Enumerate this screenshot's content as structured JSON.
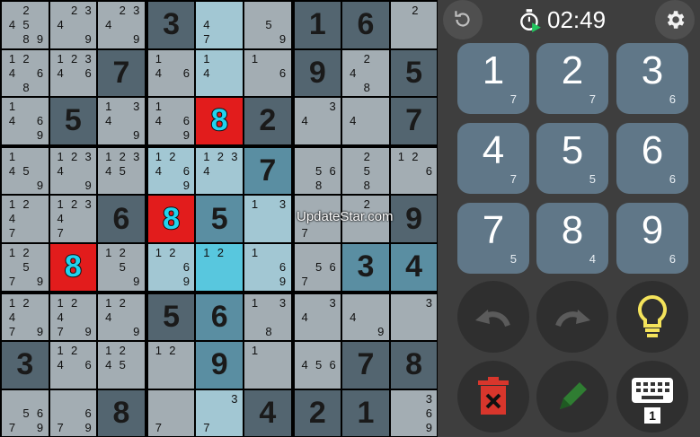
{
  "timer": "02:49",
  "watermark": "UpdateStar.com",
  "sudoku": {
    "cells": [
      [
        {
          "v": "",
          "n": "24589",
          "bg": "light"
        },
        {
          "v": "",
          "n": "2349",
          "bg": "light"
        },
        {
          "v": "",
          "n": "2349",
          "bg": "light"
        },
        {
          "v": "3",
          "n": "",
          "bg": "dark"
        },
        {
          "v": "",
          "n": "47",
          "bg": "lightblue"
        },
        {
          "v": "",
          "n": "59",
          "bg": "light"
        },
        {
          "v": "1",
          "n": "",
          "bg": "dark"
        },
        {
          "v": "6",
          "n": "",
          "bg": "dark"
        },
        {
          "v": "",
          "n": "2",
          "bg": "light"
        }
      ],
      [
        {
          "v": "",
          "n": "12468",
          "bg": "light"
        },
        {
          "v": "",
          "n": "12346",
          "bg": "light"
        },
        {
          "v": "7",
          "n": "",
          "bg": "dark"
        },
        {
          "v": "",
          "n": "146",
          "bg": "light"
        },
        {
          "v": "",
          "n": "14",
          "bg": "lightblue"
        },
        {
          "v": "",
          "n": "16",
          "bg": "light"
        },
        {
          "v": "9",
          "n": "",
          "bg": "dark"
        },
        {
          "v": "",
          "n": "248",
          "bg": "light"
        },
        {
          "v": "5",
          "n": "",
          "bg": "dark"
        }
      ],
      [
        {
          "v": "",
          "n": "1469",
          "bg": "light"
        },
        {
          "v": "5",
          "n": "",
          "bg": "dark"
        },
        {
          "v": "",
          "n": "1349",
          "bg": "light"
        },
        {
          "v": "",
          "n": "1469",
          "bg": "light"
        },
        {
          "v": "8",
          "n": "",
          "bg": "red"
        },
        {
          "v": "2",
          "n": "",
          "bg": "dark"
        },
        {
          "v": "",
          "n": "34",
          "bg": "light"
        },
        {
          "v": "",
          "n": "4",
          "bg": "light"
        },
        {
          "v": "7",
          "n": "",
          "bg": "dark"
        }
      ],
      [
        {
          "v": "",
          "n": "1459",
          "bg": "light"
        },
        {
          "v": "",
          "n": "12349",
          "bg": "light"
        },
        {
          "v": "",
          "n": "12345",
          "bg": "light"
        },
        {
          "v": "",
          "n": "12469",
          "bg": "lightblue"
        },
        {
          "v": "",
          "n": "1234",
          "bg": "lightblue"
        },
        {
          "v": "7",
          "n": "",
          "bg": "blue"
        },
        {
          "v": "",
          "n": "568",
          "bg": "light"
        },
        {
          "v": "",
          "n": "258",
          "bg": "light"
        },
        {
          "v": "",
          "n": "126",
          "bg": "light"
        }
      ],
      [
        {
          "v": "",
          "n": "1247",
          "bg": "light"
        },
        {
          "v": "",
          "n": "12347",
          "bg": "light"
        },
        {
          "v": "6",
          "n": "",
          "bg": "dark"
        },
        {
          "v": "8",
          "n": "",
          "bg": "red"
        },
        {
          "v": "5",
          "n": "",
          "bg": "blue"
        },
        {
          "v": "",
          "n": "13",
          "bg": "lightblue"
        },
        {
          "v": "",
          "n": "7",
          "bg": "light"
        },
        {
          "v": "",
          "n": "2",
          "bg": "light"
        },
        {
          "v": "9",
          "n": "",
          "bg": "dark"
        }
      ],
      [
        {
          "v": "",
          "n": "12579",
          "bg": "light"
        },
        {
          "v": "8",
          "n": "",
          "bg": "red"
        },
        {
          "v": "",
          "n": "1259",
          "bg": "light"
        },
        {
          "v": "",
          "n": "1269",
          "bg": "lightblue"
        },
        {
          "v": "",
          "n": "12",
          "bg": "cyan"
        },
        {
          "v": "",
          "n": "169",
          "bg": "lightblue"
        },
        {
          "v": "",
          "n": "567",
          "bg": "light"
        },
        {
          "v": "3",
          "n": "",
          "bg": "blue"
        },
        {
          "v": "4",
          "n": "",
          "bg": "blue"
        }
      ],
      [
        {
          "v": "",
          "n": "14279",
          "bg": "light"
        },
        {
          "v": "",
          "n": "12479",
          "bg": "light"
        },
        {
          "v": "",
          "n": "1249",
          "bg": "light"
        },
        {
          "v": "5",
          "n": "",
          "bg": "dark"
        },
        {
          "v": "6",
          "n": "",
          "bg": "blue"
        },
        {
          "v": "",
          "n": "138",
          "bg": "light"
        },
        {
          "v": "",
          "n": "34",
          "bg": "light"
        },
        {
          "v": "",
          "n": "49",
          "bg": "light"
        },
        {
          "v": "",
          "n": "3",
          "bg": "light"
        }
      ],
      [
        {
          "v": "3",
          "n": "",
          "bg": "dark"
        },
        {
          "v": "",
          "n": "1246",
          "bg": "light"
        },
        {
          "v": "",
          "n": "1245",
          "bg": "light"
        },
        {
          "v": "",
          "n": "12",
          "bg": "light"
        },
        {
          "v": "9",
          "n": "",
          "bg": "blue"
        },
        {
          "v": "",
          "n": "1",
          "bg": "light"
        },
        {
          "v": "",
          "n": "456",
          "bg": "light"
        },
        {
          "v": "7",
          "n": "",
          "bg": "dark"
        },
        {
          "v": "8",
          "n": "",
          "bg": "dark"
        }
      ],
      [
        {
          "v": "",
          "n": "5679",
          "bg": "light"
        },
        {
          "v": "",
          "n": "679",
          "bg": "light"
        },
        {
          "v": "8",
          "n": "",
          "bg": "dark"
        },
        {
          "v": "",
          "n": "7",
          "bg": "light"
        },
        {
          "v": "",
          "n": "37",
          "bg": "lightblue"
        },
        {
          "v": "4",
          "n": "",
          "bg": "dark"
        },
        {
          "v": "2",
          "n": "",
          "bg": "dark"
        },
        {
          "v": "1",
          "n": "",
          "bg": "dark"
        },
        {
          "v": "",
          "n": "369",
          "bg": "light"
        }
      ]
    ]
  },
  "numpad": [
    {
      "digit": "1",
      "count": "7"
    },
    {
      "digit": "2",
      "count": "7"
    },
    {
      "digit": "3",
      "count": "6"
    },
    {
      "digit": "4",
      "count": "7"
    },
    {
      "digit": "5",
      "count": "5"
    },
    {
      "digit": "6",
      "count": "6"
    },
    {
      "digit": "7",
      "count": "5"
    },
    {
      "digit": "8",
      "count": "4"
    },
    {
      "digit": "9",
      "count": "6"
    }
  ],
  "keyboard_badge": "1",
  "colors": {
    "light": "#a3adb3",
    "dark": "#536570",
    "blue": "#5a8ea2",
    "lightblue": "#a2c7d3",
    "cyan": "#58c7de",
    "red": "#e21c1c",
    "hl": "#22d3ee",
    "numbtn": "#607788",
    "bulb": "#f4e35b",
    "trash": "#d8362c",
    "pencil": "#2f7d32",
    "panel": "#3e3e3e"
  },
  "icons": {
    "reset": "reset-icon",
    "settings": "gear-icon",
    "timer": "stopwatch-icon",
    "undo": "undo-icon",
    "redo": "redo-icon",
    "hint": "lightbulb-icon",
    "delete": "trash-icon",
    "pencil": "pencil-icon",
    "keyboard": "keyboard-icon"
  }
}
